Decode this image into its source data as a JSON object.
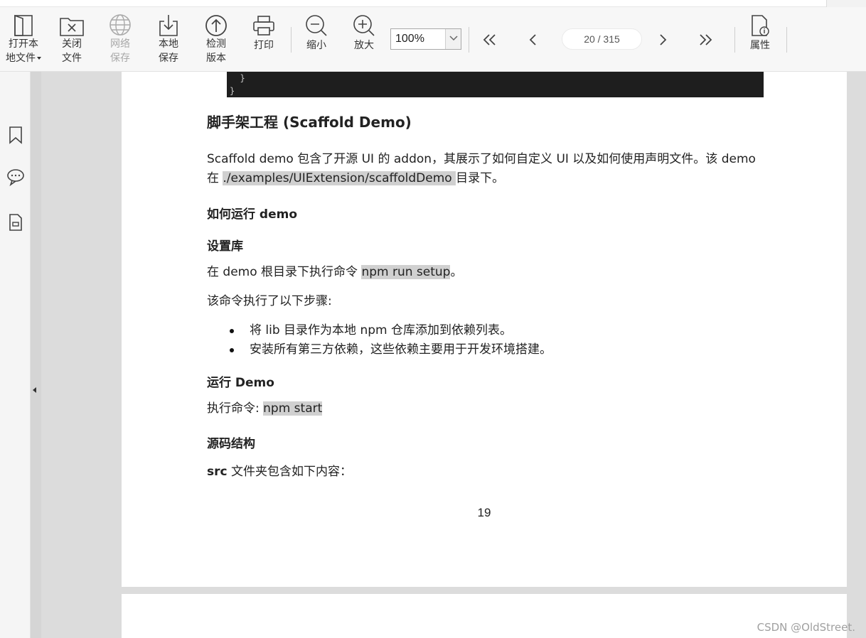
{
  "toolbar": {
    "open_local_line1": "打开本",
    "open_local_line2": "地文件",
    "close_line1": "关闭",
    "close_line2": "文件",
    "network_save_line1": "网络",
    "network_save_line2": "保存",
    "local_save_line1": "本地",
    "local_save_line2": "保存",
    "check_version_line1": "检测",
    "check_version_line2": "版本",
    "print": "打印",
    "zoom_out": "缩小",
    "zoom_in": "放大",
    "zoom_value": "100%",
    "page_indicator": "20 / 315",
    "properties": "属性"
  },
  "document": {
    "code_lines": [
      "  }",
      "}"
    ],
    "heading": "脚手架工程 (Scaffold Demo)",
    "intro_line1": "Scaffold demo 包含了开源 UI 的 addon，其展示了如何自定义 UI 以及如何使用声明文件。该 demo",
    "intro_line2_prefix": "在 ",
    "intro_path": "./examples/UIExtension/scaffoldDemo ",
    "intro_line2_suffix": "目录下。",
    "how_to_run": "如何运行 demo",
    "setup_lib": "设置库",
    "setup_prefix": "在 demo 根目录下执行命令 ",
    "setup_cmd": "npm run setup",
    "setup_suffix": "。",
    "steps_intro": "该命令执行了以下步骤:",
    "bullets": [
      "将 lib 目录作为本地 npm 仓库添加到依赖列表。",
      "安装所有第三方依赖，这些依赖主要用于开发环境搭建。"
    ],
    "run_demo": "运行 Demo",
    "run_prefix": "执行命令: ",
    "run_cmd": "npm start",
    "source_structure": "源码结构",
    "src_bold": "src",
    "src_rest": " 文件夹包含如下内容：",
    "page_number": "19"
  },
  "watermark": "CSDN @OldStreet."
}
